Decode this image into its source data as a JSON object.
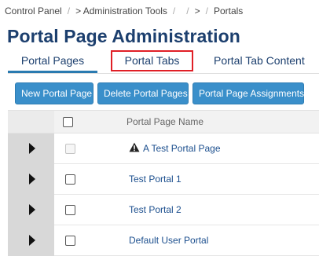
{
  "breadcrumb": {
    "items": [
      "Control Panel",
      "> Administration Tools",
      "",
      ">",
      "Portals"
    ],
    "separator": "/"
  },
  "page": {
    "title": "Portal Page Administration"
  },
  "tabs": [
    {
      "label": "Portal Pages",
      "active": true
    },
    {
      "label": "Portal Tabs",
      "highlighted": true
    },
    {
      "label": "Portal Tab Content"
    }
  ],
  "toolbar": {
    "new_label": "New Portal Page",
    "delete_label": "Delete Portal Pages",
    "assign_label": "Portal Page Assignments"
  },
  "grid": {
    "column_name": "Portal Page Name",
    "rows": [
      {
        "name": "A Test Portal Page",
        "icon": "warning-icon",
        "checkbox_disabled": true
      },
      {
        "name": "Test Portal 1"
      },
      {
        "name": "Test Portal 2"
      },
      {
        "name": "Default User Portal"
      }
    ]
  },
  "colors": {
    "title": "#1c3f6e",
    "button": "#3a8fca",
    "highlight_box": "#e01f26",
    "link": "#1c4f8e"
  }
}
